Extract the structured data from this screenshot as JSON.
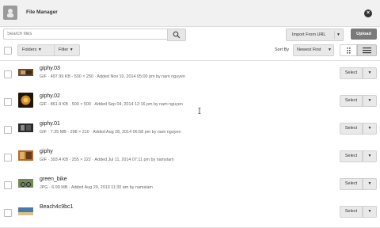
{
  "header": {
    "title": "File Manager"
  },
  "search": {
    "placeholder": "Search files"
  },
  "actions": {
    "import_label": "Import From URL",
    "upload_label": "Upload"
  },
  "toolbar": {
    "folders_label": "Folders",
    "filter_label": "Filter",
    "sort_by_label": "Sort By",
    "sort_value": "Newest First"
  },
  "row_actions": {
    "select_label": "Select"
  },
  "files": [
    {
      "name": "giphy.03",
      "meta": "GIF · 497.99 KB · 500 × 250 · Added Nov 10, 2014 05:00 pm by nam nguyen"
    },
    {
      "name": "giphy.02",
      "meta": "GIF · 861.9 KB · 500 × 500 · Added Sep 04, 2014 12:16 pm by nam nguyen"
    },
    {
      "name": "giphy.01",
      "meta": "GIF · 7.35 MB · 298 × 210 · Added Aug 28, 2014 06:58 pm by nam nguyen"
    },
    {
      "name": "giphy",
      "meta": "GIF · 393.4 KB · 255 × 222 · Added Jul 11, 2014 07:11 pm by namslam"
    },
    {
      "name": "green_bike",
      "meta": "JPG · 6.99 MB · Added Aug 29, 2013 11:30 am by namslam"
    },
    {
      "name": "Beach4c9bc1",
      "meta": ""
    }
  ],
  "colors": {
    "header_bg": "#f1f1f1",
    "upload_bg": "#7a7a7a"
  }
}
